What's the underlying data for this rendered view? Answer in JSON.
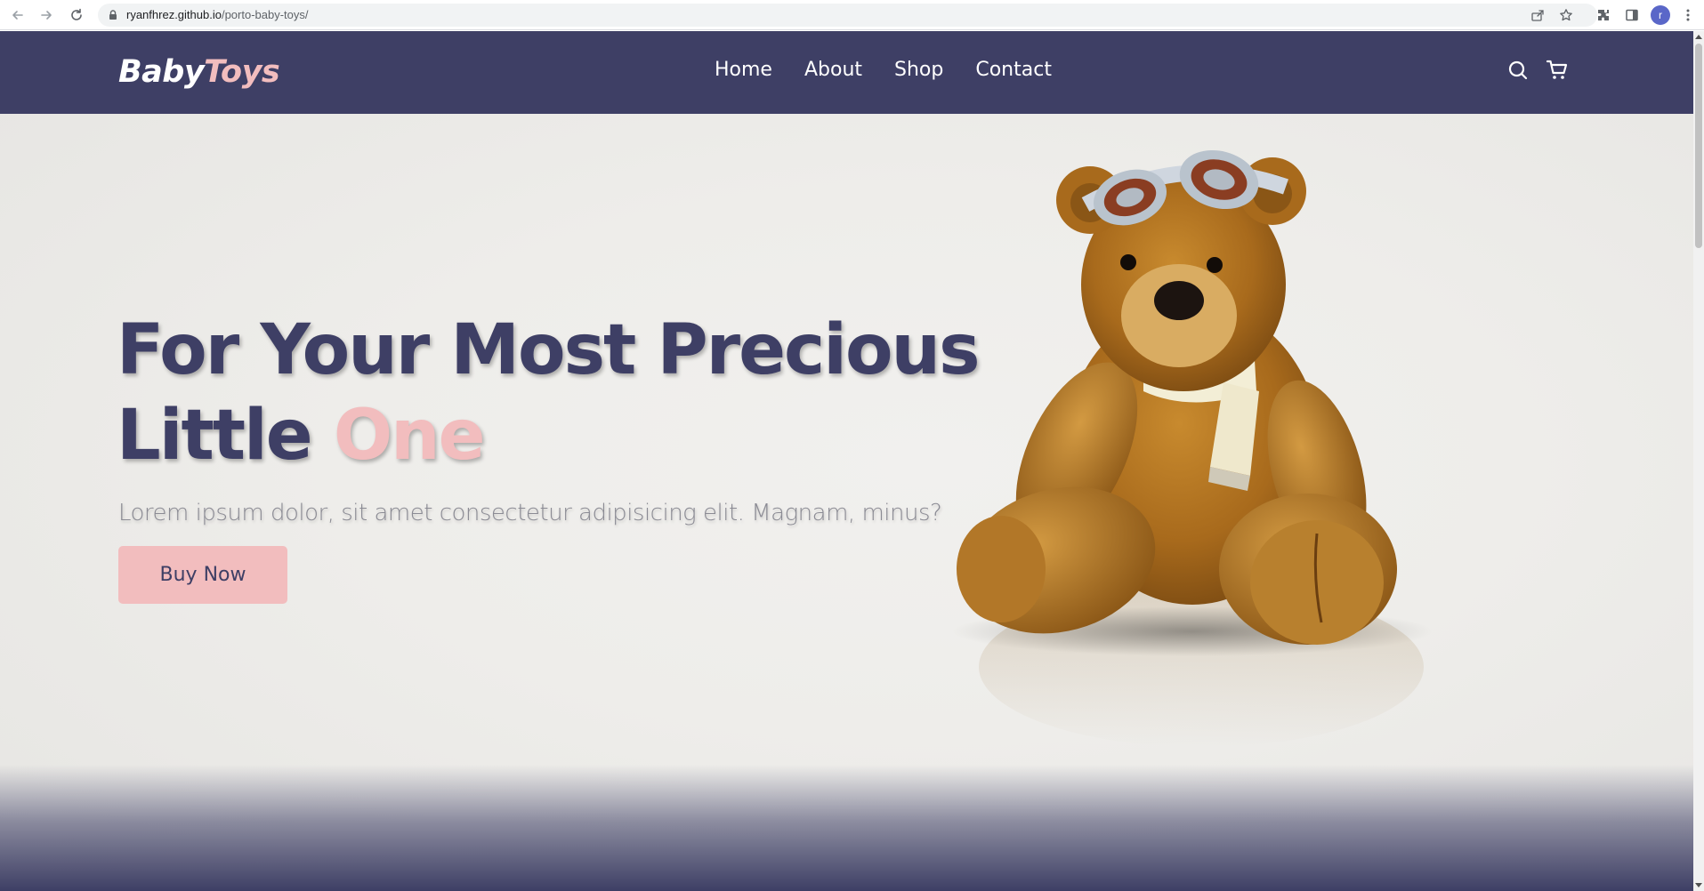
{
  "browser": {
    "url_host": "ryanfhrez.github.io",
    "url_path": "/porto-baby-toys/",
    "profile_initial": "r",
    "icons": [
      "back-arrow-icon",
      "forward-arrow-icon",
      "reload-icon",
      "lock-icon",
      "share-icon",
      "star-icon",
      "extensions-icon",
      "side-panel-icon",
      "menu-dots-icon"
    ]
  },
  "header": {
    "logo_part1": "Baby",
    "logo_part2": "Toys",
    "nav": [
      {
        "label": "Home"
      },
      {
        "label": "About"
      },
      {
        "label": "Shop"
      },
      {
        "label": "Contact"
      }
    ],
    "icons": [
      "search-icon",
      "cart-icon"
    ]
  },
  "hero": {
    "title_line1": "For Your Most Precious",
    "title_line2_a": "Little",
    "title_line2_b": "One",
    "subtitle": "Lorem ipsum dolor, sit amet consectetur adipisicing elit. Magnam, minus?",
    "cta_label": "Buy Now",
    "image": "teddy-bear-with-goggles-and-scarf"
  },
  "colors": {
    "primary": "#3e3f65",
    "accent": "#f2bdbe",
    "hero_bg": "#eeedea",
    "subtitle": "#8b8b94"
  }
}
